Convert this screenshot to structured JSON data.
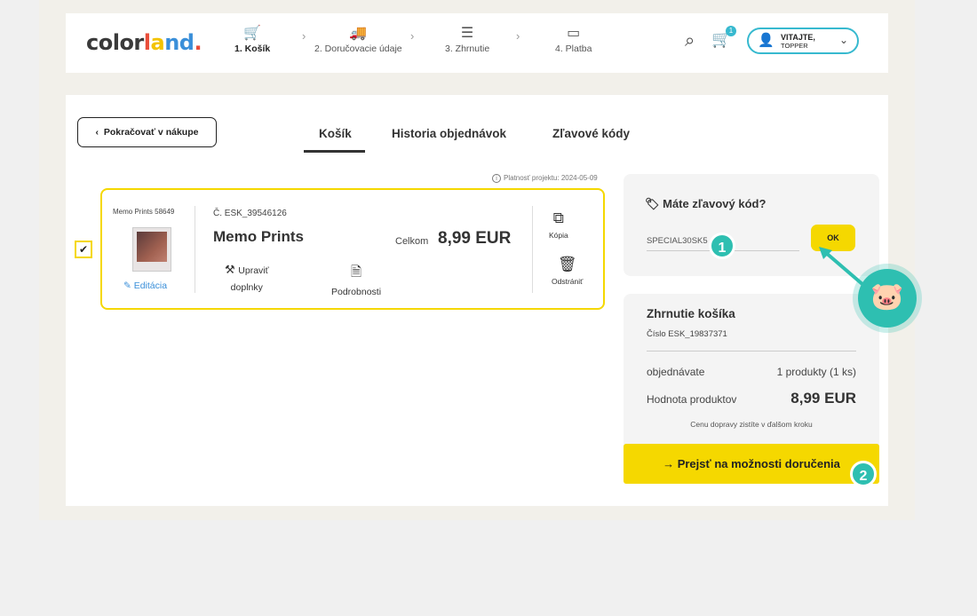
{
  "logo": {
    "part1": "color",
    "part2": "l",
    "part3": "a",
    "part4": "nd",
    "part5": "."
  },
  "steps": [
    {
      "label": "1. Košík"
    },
    {
      "label": "2. Doručovacie údaje"
    },
    {
      "label": "3. Zhrnutie"
    },
    {
      "label": "4. Platba"
    }
  ],
  "header": {
    "cart_count": "1",
    "user_greeting": "VITAJTE,",
    "user_name": "TOPPER"
  },
  "nav": {
    "back_label": "Pokračovať v nákupe"
  },
  "tabs": [
    {
      "label": "Košík"
    },
    {
      "label": "Historia objednávok"
    },
    {
      "label": "Zľavové kódy"
    }
  ],
  "project": {
    "validity": "Platnosť projektu: 2024-05-09"
  },
  "item": {
    "small_name": "Memo Prints 58649",
    "edit_label": "Editácia",
    "order_no": "Č. ESK_39546126",
    "title": "Memo Prints",
    "total_label": "Celkom",
    "total_value": "8,99 EUR",
    "addons_label_1": "Upraviť",
    "addons_label_2": "doplnky",
    "details_label": "Podrobnosti",
    "copy_label": "Kópia",
    "delete_label": "Odstrániť",
    "checked": "✔"
  },
  "coupon": {
    "title": "Máte zľavový kód?",
    "value": "SPECIAL30SK5",
    "ok_label": "OK",
    "badge": "1"
  },
  "summary": {
    "title": "Zhrnutie košíka",
    "subtitle": "Číslo ESK_19837371",
    "row1_label": "objednávate",
    "row1_value": "1 produkty (1 ks)",
    "row2_label": "Hodnota produktov",
    "row2_value": "8,99 EUR",
    "note": "Cenu dopravy zistíte v ďalšom kroku",
    "cta_label": "→ Prejsť na možnosti doručenia",
    "cta_badge": "2"
  },
  "colors": {
    "accent_yellow": "#f5d800",
    "accent_teal": "#2ebfb1",
    "link_blue": "#3a8fd9"
  }
}
